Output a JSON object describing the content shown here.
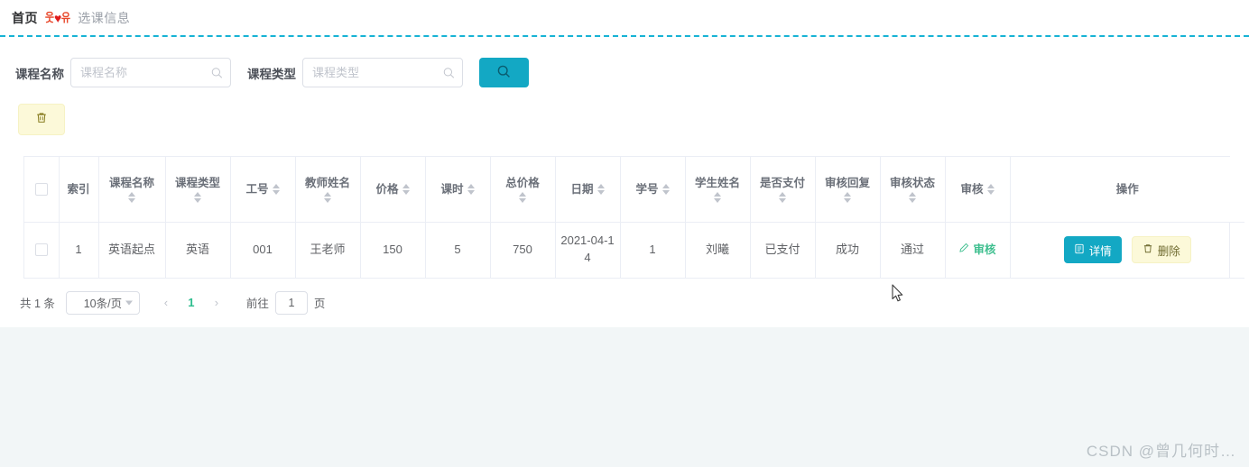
{
  "breadcrumb": {
    "home": "首页",
    "separator_left": "웃",
    "separator_heart": "♥",
    "separator_right": "유",
    "current": "选课信息"
  },
  "search": {
    "course_name_label": "课程名称",
    "course_name_placeholder": "课程名称",
    "course_name_value": "",
    "course_type_label": "课程类型",
    "course_type_placeholder": "课程类型",
    "course_type_value": "",
    "search_icon": "search-icon"
  },
  "toolbar": {
    "bulk_delete_icon": "trash-icon"
  },
  "table": {
    "columns": [
      {
        "label": "",
        "sortable": false,
        "kind": "checkbox"
      },
      {
        "label": "索引",
        "sortable": false,
        "stack": false
      },
      {
        "label": "课程名称",
        "sortable": true,
        "stack": true
      },
      {
        "label": "课程类型",
        "sortable": true,
        "stack": true
      },
      {
        "label": "工号",
        "sortable": true,
        "stack": false
      },
      {
        "label": "教师姓名",
        "sortable": true,
        "stack": true
      },
      {
        "label": "价格",
        "sortable": true,
        "stack": false
      },
      {
        "label": "课时",
        "sortable": true,
        "stack": false
      },
      {
        "label": "总价格",
        "sortable": true,
        "stack": true
      },
      {
        "label": "日期",
        "sortable": true,
        "stack": false
      },
      {
        "label": "学号",
        "sortable": true,
        "stack": false
      },
      {
        "label": "学生姓名",
        "sortable": true,
        "stack": true
      },
      {
        "label": "是否支付",
        "sortable": true,
        "stack": true
      },
      {
        "label": "审核回复",
        "sortable": true,
        "stack": true
      },
      {
        "label": "审核状态",
        "sortable": true,
        "stack": true
      },
      {
        "label": "审核",
        "sortable": true,
        "stack": false
      },
      {
        "label": "操作",
        "sortable": false,
        "stack": false
      }
    ],
    "rows": [
      {
        "index": "1",
        "course_name": "英语起点",
        "course_type": "英语",
        "teacher_id": "001",
        "teacher_name": "王老师",
        "price": "150",
        "hours": "5",
        "total_price": "750",
        "date": "2021-04-14",
        "student_id": "1",
        "student_name": "刘曦",
        "paid": "已支付",
        "audit_reply": "成功",
        "audit_status": "通过",
        "audit_link": "审核",
        "detail_button": "详情",
        "delete_button": "删除"
      }
    ]
  },
  "pagination": {
    "total_text": "共 1 条",
    "page_size": "10条/页",
    "prev": "‹",
    "next": "›",
    "current_page": "1",
    "jump_label": "前往",
    "jump_value": "1",
    "jump_suffix": "页"
  },
  "watermark": "CSDN @曾几何时…",
  "colors": {
    "accent_teal": "#13a8c4",
    "dashed_rule": "#17b3d4",
    "warn_yellow": "#fcf9d9",
    "link_green": "#3fbf8f",
    "page_active_green": "#2ebd8e",
    "page_bg": "#f2f6f7"
  }
}
